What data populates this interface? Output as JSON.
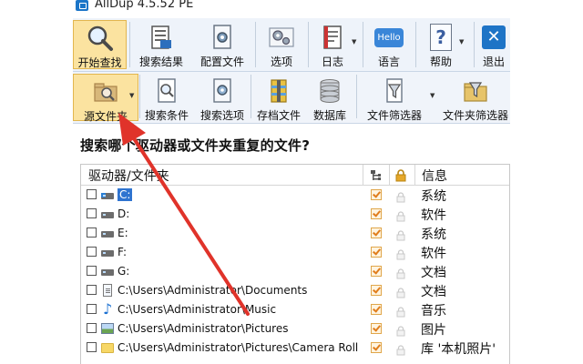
{
  "window": {
    "title": "AllDup 4.5.52 PE"
  },
  "toolbar_main": {
    "buttons": [
      {
        "label": "开始查找",
        "icon": "magnifier-icon"
      },
      {
        "label": "搜索结果",
        "icon": "results-icon"
      },
      {
        "label": "配置文件",
        "icon": "config-file-icon"
      },
      {
        "label": "选项",
        "icon": "options-gears-icon"
      },
      {
        "label": "日志",
        "icon": "log-icon"
      },
      {
        "label": "语言",
        "icon": "hello-bubble-icon"
      },
      {
        "label": "帮助",
        "icon": "help-icon"
      },
      {
        "label": "退出",
        "icon": "exit-icon"
      }
    ],
    "hello_text": "Hello",
    "help_glyph": "?",
    "exit_glyph": "✕"
  },
  "toolbar_secondary": {
    "buttons": [
      {
        "label": "源文件夹",
        "icon": "source-folder-icon"
      },
      {
        "label": "搜索条件",
        "icon": "search-criteria-icon"
      },
      {
        "label": "搜索选项",
        "icon": "search-options-icon"
      },
      {
        "label": "存档文件",
        "icon": "archive-icon"
      },
      {
        "label": "数据库",
        "icon": "database-icon"
      },
      {
        "label": "文件筛选器",
        "icon": "file-filter-icon"
      },
      {
        "label": "文件夹筛选器",
        "icon": "folder-filter-icon"
      }
    ]
  },
  "question": "搜索哪个驱动器或文件夹重复的文件?",
  "table": {
    "headers": {
      "name": "驱动器/文件夹",
      "info": "信息"
    },
    "rows": [
      {
        "name": "C:",
        "info": "系统",
        "icon": "system-drive-icon"
      },
      {
        "name": "D:",
        "info": "软件",
        "icon": "drive-icon"
      },
      {
        "name": "E:",
        "info": "系统",
        "icon": "drive-icon"
      },
      {
        "name": "F:",
        "info": "软件",
        "icon": "drive-icon"
      },
      {
        "name": "G:",
        "info": "文档",
        "icon": "drive-icon"
      },
      {
        "name": "C:\\Users\\Administrator\\Documents",
        "info": "文档",
        "icon": "document-icon"
      },
      {
        "name": "C:\\Users\\Administrator\\Music",
        "info": "音乐",
        "icon": "music-note-icon"
      },
      {
        "name": "C:\\Users\\Administrator\\Pictures",
        "info": "图片",
        "icon": "picture-icon"
      },
      {
        "name": "C:\\Users\\Administrator\\Pictures\\Camera Roll",
        "info": "库 '本机照片'",
        "icon": "folder-icon"
      }
    ]
  },
  "colors": {
    "toolbar_bg": "#eef3fa",
    "active_btn": "#fbe3a0",
    "annotation_arrow": "#e0332a",
    "checkmark": "#e07d1c"
  }
}
